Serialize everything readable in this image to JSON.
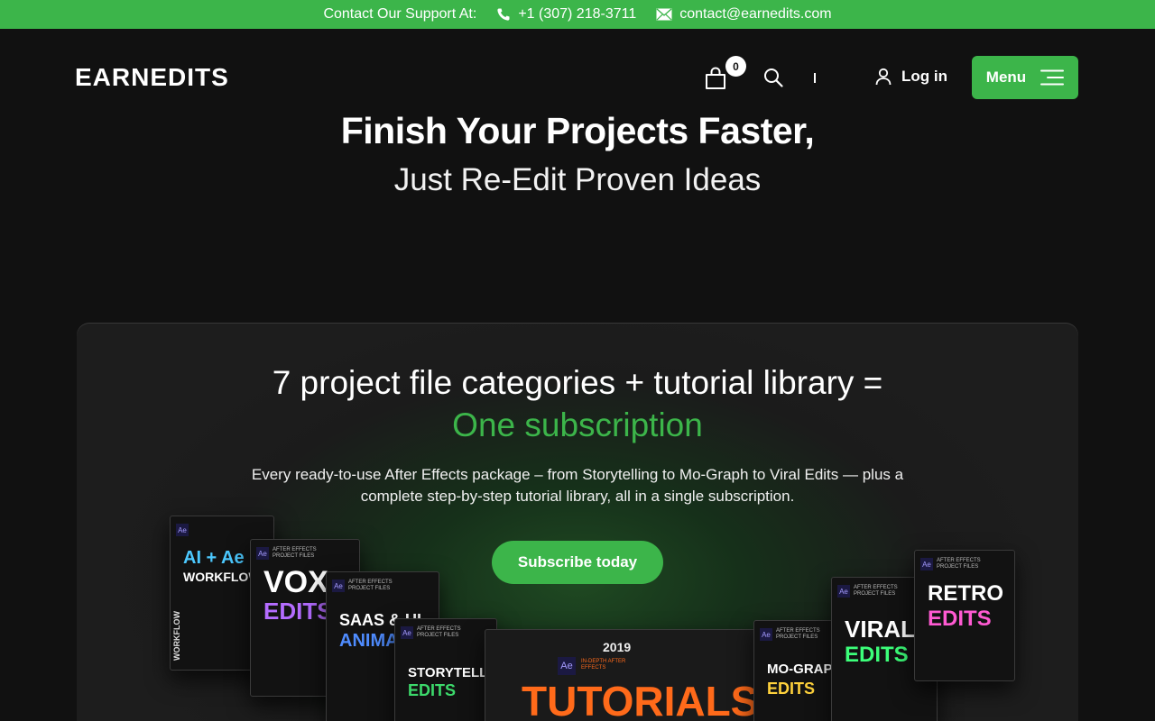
{
  "topbar": {
    "label": "Contact Our Support At:",
    "phone": "+1 (307) 218-3711",
    "email": "contact@earnedits.com",
    "bg_color": "#3cb54a"
  },
  "header": {
    "logo": "EARNEDITS",
    "cart_count": "0",
    "login_label": "Log in",
    "menu_label": "Menu",
    "icons": [
      "cart-icon",
      "search-icon",
      "user-icon",
      "hamburger-icon"
    ]
  },
  "hero": {
    "title": "Finish Your Projects Faster,",
    "subtitle": "Just Re-Edit Proven Ideas"
  },
  "promo": {
    "heading_line1": "7 project file categories + tutorial library =",
    "heading_line2": "One subscription",
    "description": "Every ready-to-use After Effects package – from Storytelling to Mo-Graph to Viral Edits — plus a complete step-by-step tutorial library, all in a single subscription.",
    "cta_label": "Subscribe today",
    "accent_color": "#3cb54a",
    "products": [
      {
        "title": "AI + Ae",
        "subtitle": "WORKFLOW",
        "color": "#4cc9ff"
      },
      {
        "title": "VOX",
        "subtitle": "EDITS",
        "color": "#b46cff"
      },
      {
        "title": "SAAS & UI",
        "subtitle": "ANIMA",
        "color": "#4f8cff"
      },
      {
        "title": "STORYTELLIN",
        "subtitle": "EDITS",
        "color": "#3cd96b"
      },
      {
        "title": "TUTORIALS",
        "subtitle": "2019",
        "color": "#ff6a1a"
      },
      {
        "title": "MO-GRAPH",
        "subtitle": "EDITS",
        "color": "#ffd23c"
      },
      {
        "title": "VIRAL",
        "subtitle": "EDITS",
        "color": "#3cff7a"
      },
      {
        "title": "RETRO",
        "subtitle": "EDITS",
        "color": "#ff5ad2"
      }
    ],
    "box_label": "AFTER EFFECTS PROJECT FILES",
    "tutorial_badge": "IN-DEPTH AFTER EFFECTS"
  }
}
